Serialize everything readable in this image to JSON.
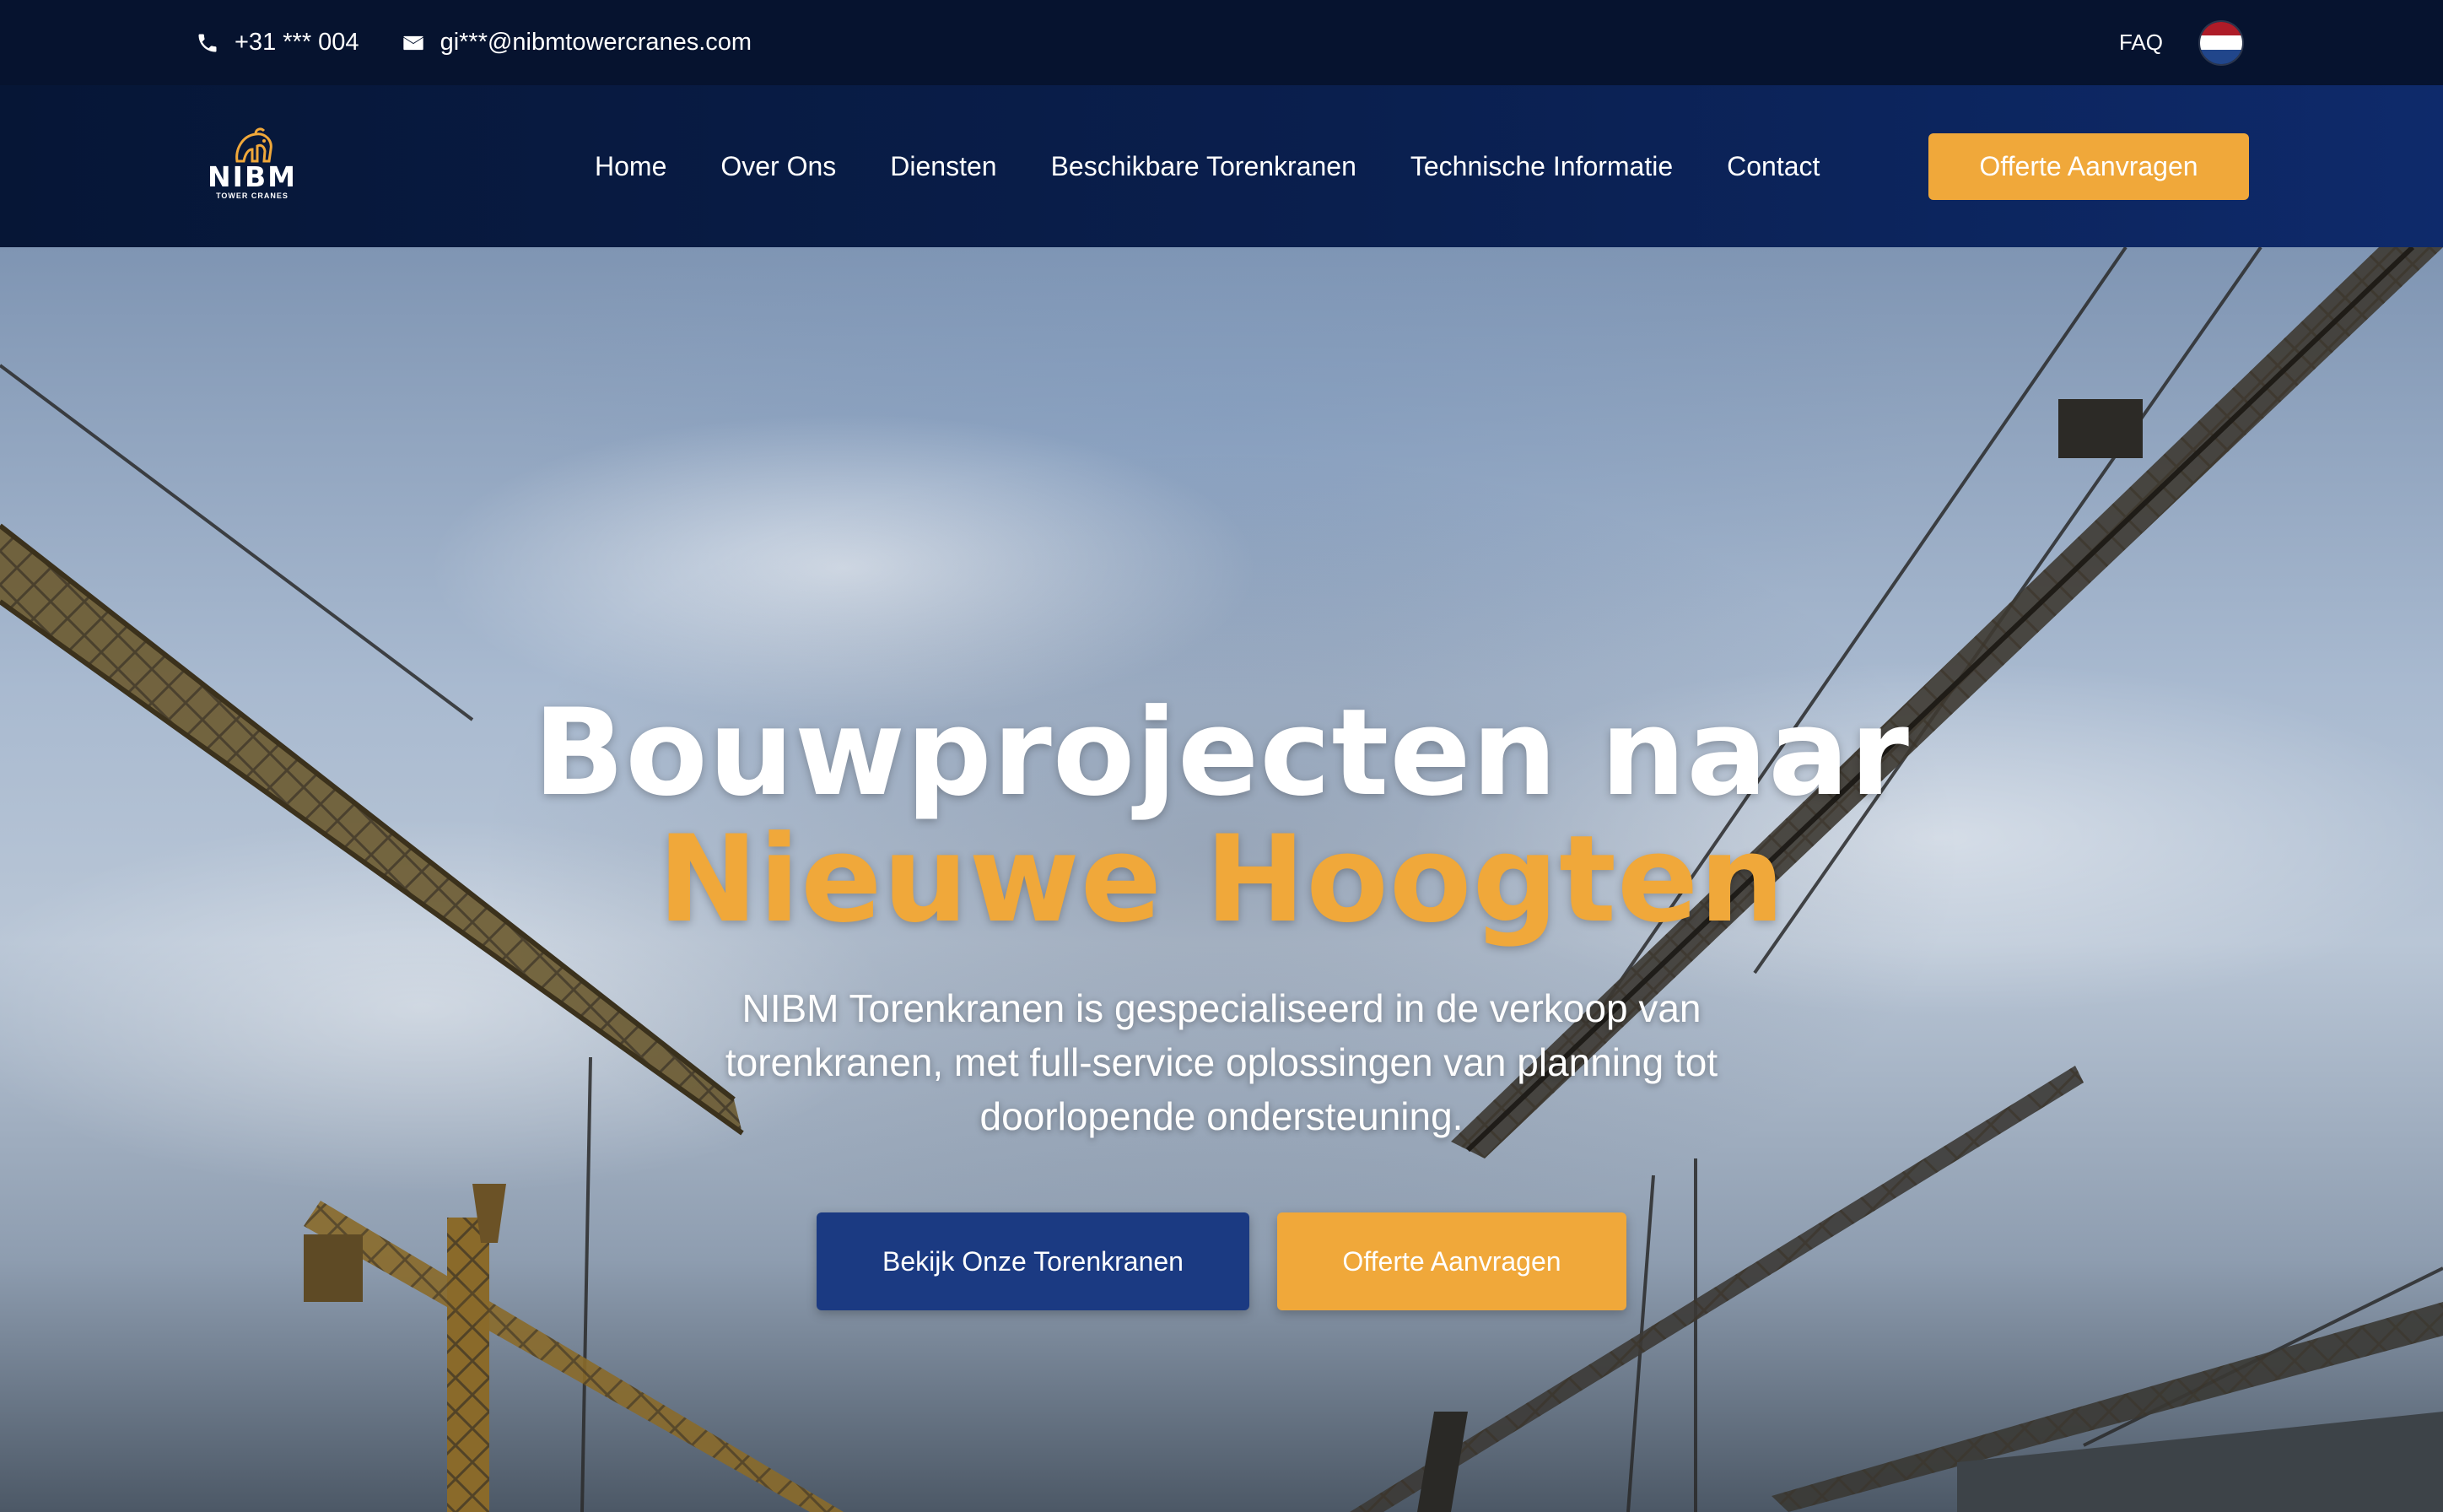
{
  "topbar": {
    "phone": "+31 *** 004",
    "email": "gi***@nibmtowercranes.com",
    "faq": "FAQ",
    "language_flag": "nl-flag-icon",
    "icons": {
      "phone": "phone-icon",
      "email": "envelope-icon"
    }
  },
  "logo": {
    "brand": "NIBM",
    "subtitle": "TOWER CRANES"
  },
  "nav": {
    "items": [
      {
        "label": "Home"
      },
      {
        "label": "Over Ons"
      },
      {
        "label": "Diensten"
      },
      {
        "label": "Beschikbare Torenkranen"
      },
      {
        "label": "Technische Informatie"
      },
      {
        "label": "Contact"
      }
    ],
    "cta": "Offerte Aanvragen"
  },
  "hero": {
    "title_line1": "Bouwprojecten naar",
    "title_line2": "Nieuwe Hoogten",
    "subtitle": "NIBM Torenkranen is gespecialiseerd in de verkoop van torenkranen, met full-service oplossingen van planning tot doorlopende ondersteuning.",
    "primary_button": "Bekijk Onze Torenkranen",
    "secondary_button": "Offerte Aanvragen"
  },
  "colors": {
    "topbar_bg": "#06132f",
    "navbar_bg": "#0a1f4e",
    "accent_orange": "#f0a83a",
    "primary_blue": "#1b3a82",
    "text_white": "#ffffff"
  }
}
